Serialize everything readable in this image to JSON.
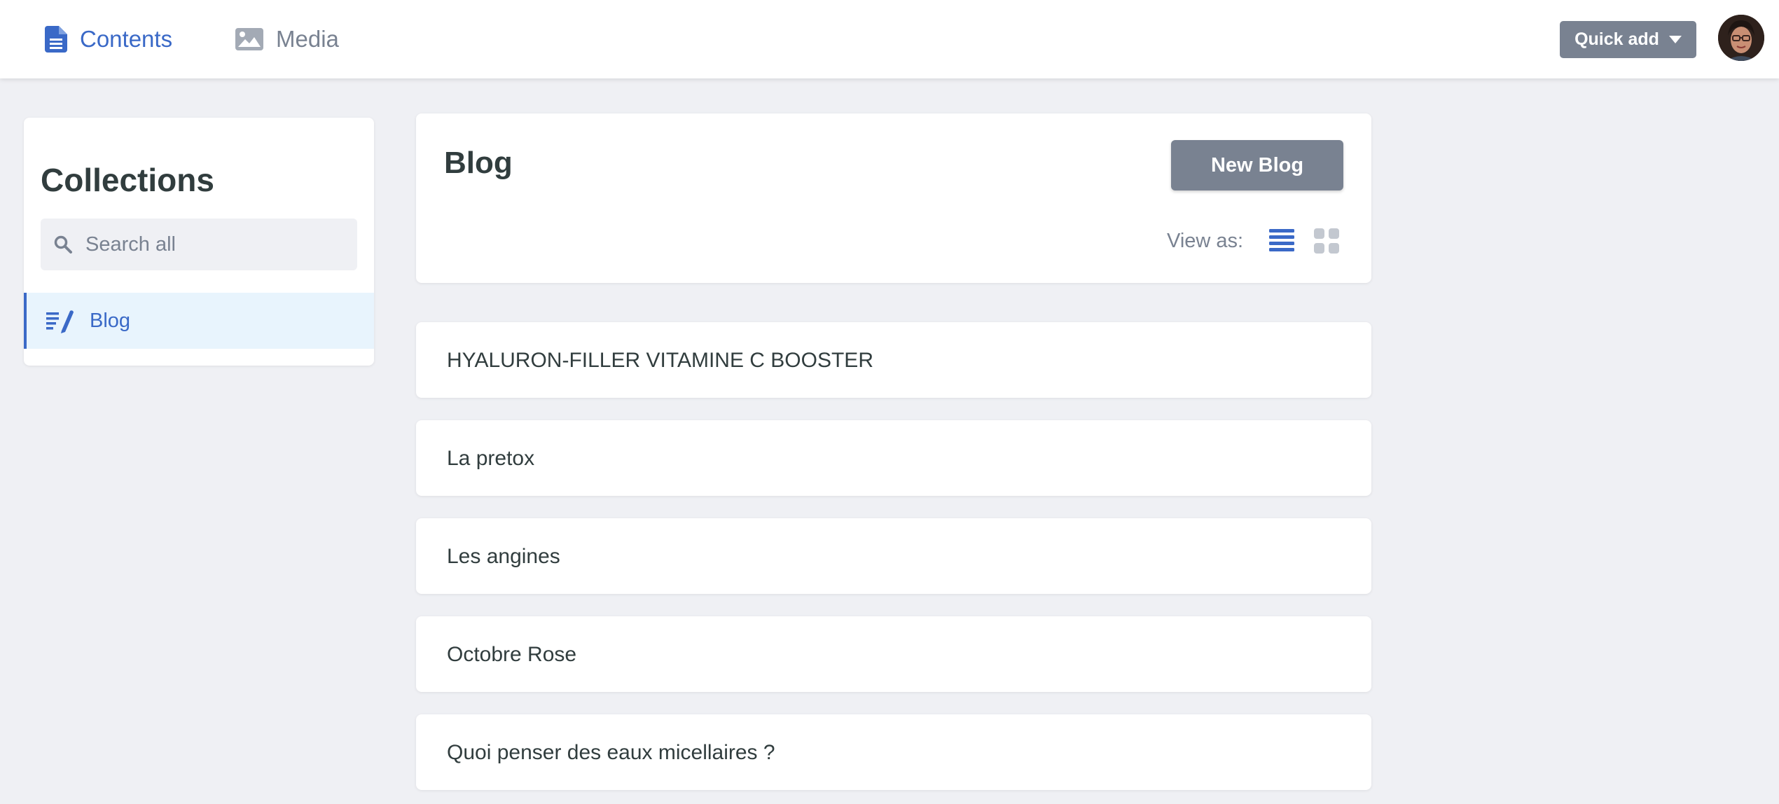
{
  "topbar": {
    "nav": [
      {
        "label": "Contents",
        "icon": "document-icon",
        "active": true
      },
      {
        "label": "Media",
        "icon": "image-icon",
        "active": false
      }
    ],
    "quick_add_label": "Quick add",
    "avatar": "user-avatar"
  },
  "sidebar": {
    "title": "Collections",
    "search_placeholder": "Search all",
    "items": [
      {
        "label": "Blog",
        "icon": "edit-list-icon",
        "active": true
      }
    ]
  },
  "main": {
    "title": "Blog",
    "new_button_label": "New Blog",
    "view_as_label": "View as:",
    "view_modes": [
      {
        "icon": "list-view-icon",
        "active": true
      },
      {
        "icon": "grid-view-icon",
        "active": false
      }
    ],
    "entries": [
      "HYALURON-FILLER VITAMINE C BOOSTER",
      "La pretox",
      "Les angines",
      "Octobre Rose",
      "Quoi penser des eaux micellaires ?"
    ]
  },
  "colors": {
    "accent": "#3a69c7",
    "muted": "#798291",
    "background": "#eff0f4",
    "active_item_bg": "#e8f4fd",
    "text": "#313d3e"
  }
}
